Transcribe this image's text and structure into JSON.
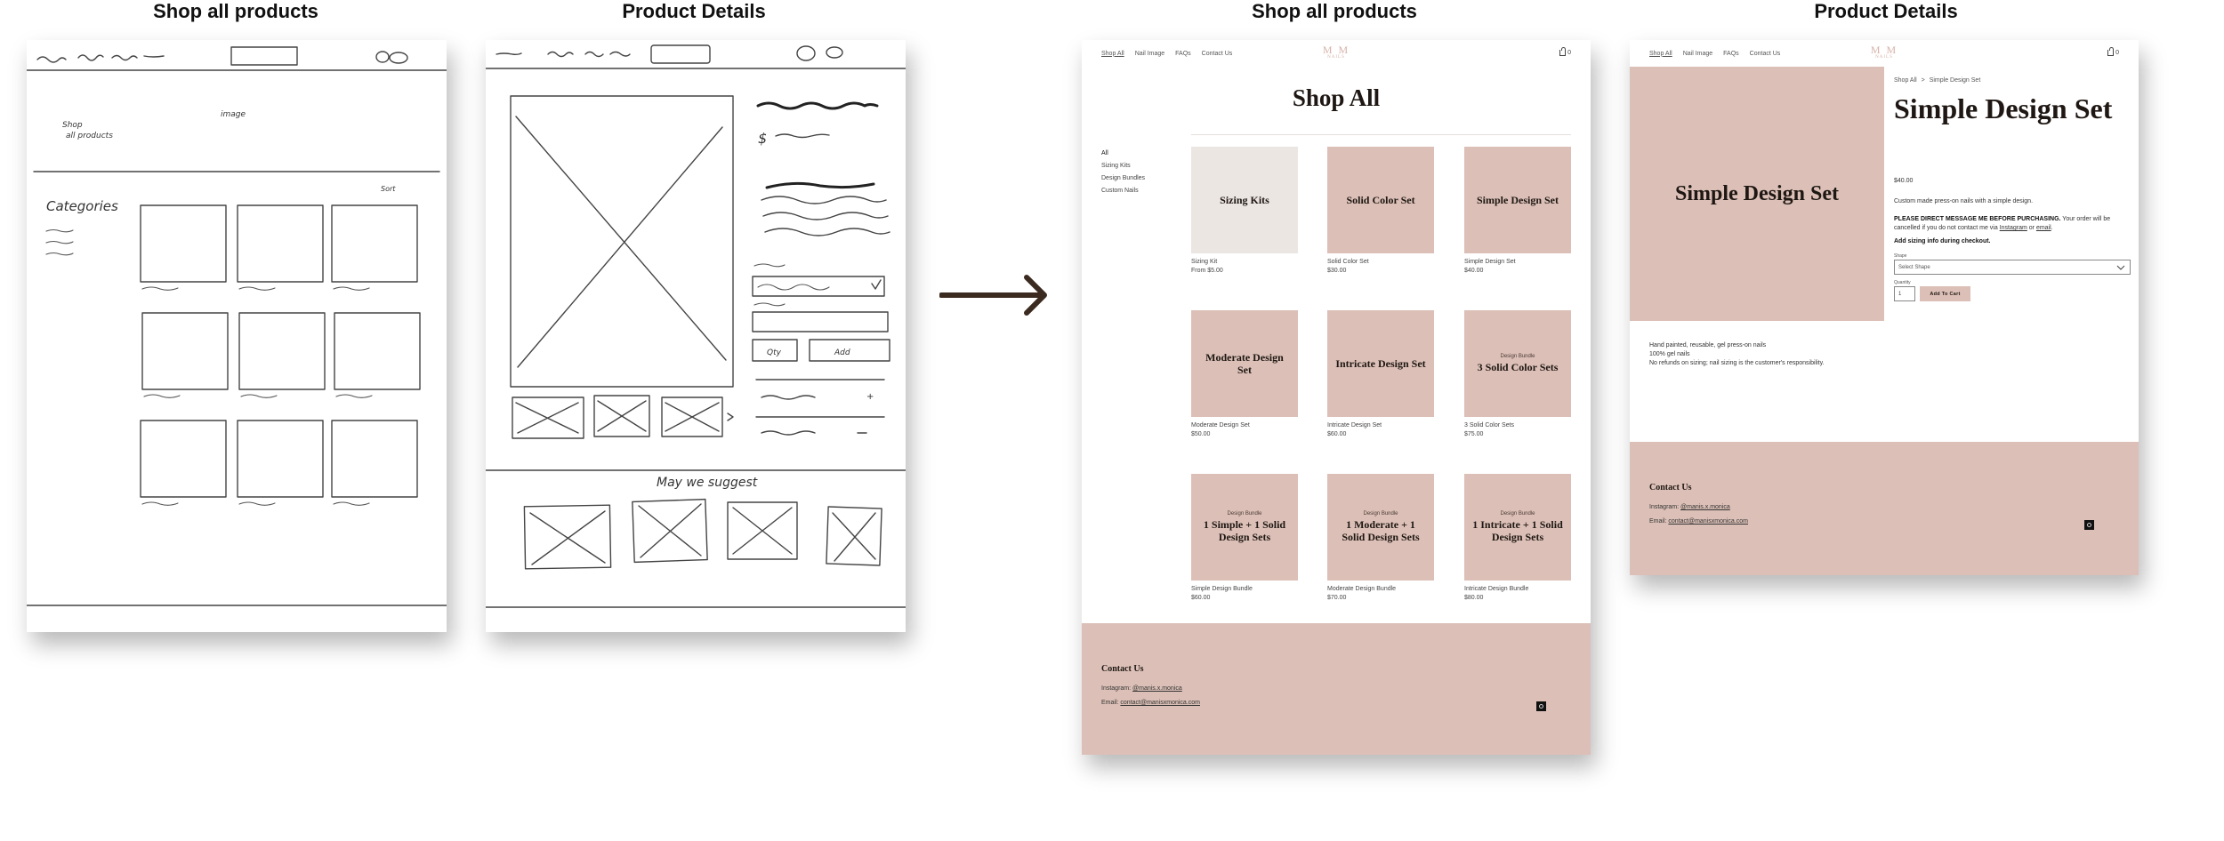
{
  "titles": {
    "sketch_shop": "Shop all products",
    "sketch_detail": "Product Details",
    "mock_shop": "Shop all products",
    "mock_detail": "Product Details"
  },
  "sketch_labels": {
    "image": "image",
    "shop_all": "Shop\nall products",
    "categories": "Categories",
    "sort": "Sort",
    "may_we_suggest": "May we suggest"
  },
  "nav": {
    "items": [
      "Shop All",
      "Nail Image",
      "FAQs",
      "Contact Us"
    ],
    "logo": "M M",
    "logo_sub": "NAILS",
    "cart_count": "0"
  },
  "shop": {
    "heading": "Shop All",
    "categories": [
      "All",
      "Sizing Kits",
      "Design Bundles",
      "Custom Nails"
    ],
    "products": [
      {
        "tag": "",
        "name": "Sizing Kits",
        "caption": "Sizing Kit",
        "price": "From $5.00",
        "bg": "#ece6e2"
      },
      {
        "tag": "",
        "name": "Solid Color Set",
        "caption": "Solid Color Set",
        "price": "$30.00",
        "bg": "#dcc0b7"
      },
      {
        "tag": "",
        "name": "Simple Design Set",
        "caption": "Simple Design Set",
        "price": "$40.00",
        "bg": "#dcc0b7"
      },
      {
        "tag": "",
        "name": "Moderate Design Set",
        "caption": "Moderate Design Set",
        "price": "$50.00",
        "bg": "#dcc0b7"
      },
      {
        "tag": "",
        "name": "Intricate Design Set",
        "caption": "Intricate Design Set",
        "price": "$60.00",
        "bg": "#dcc0b7"
      },
      {
        "tag": "Design Bundle",
        "name": "3 Solid Color Sets",
        "caption": "3 Solid Color Sets",
        "price": "$75.00",
        "bg": "#dcc0b7"
      },
      {
        "tag": "Design Bundle",
        "name": "1 Simple + 1 Solid Design Sets",
        "caption": "Simple Design Bundle",
        "price": "$60.00",
        "bg": "#dcc0b7"
      },
      {
        "tag": "Design Bundle",
        "name": "1 Moderate + 1 Solid Design Sets",
        "caption": "Moderate Design Bundle",
        "price": "$70.00",
        "bg": "#dcc0b7"
      },
      {
        "tag": "Design Bundle",
        "name": "1 Intricate + 1 Solid Design Sets",
        "caption": "Intricate Design Bundle",
        "price": "$80.00",
        "bg": "#dcc0b7"
      }
    ]
  },
  "footer": {
    "heading": "Contact Us",
    "instagram_label": "Instagram:",
    "instagram_handle": "@manis.x.monica",
    "email_label": "Email:",
    "email_value": "contact@manisxmonica.com",
    "ig_icon": "instagram-icon"
  },
  "detail": {
    "breadcrumb_root": "Shop All",
    "breadcrumb_sep": ">",
    "breadcrumb_current": "Simple Design Set",
    "image_text": "Simple Design Set",
    "title": "Simple Design Set",
    "price": "$40.00",
    "description": "Custom made press-on nails with a simple design.",
    "notice_bold": "PLEASE DIRECT MESSAGE ME BEFORE PURCHASING.",
    "notice_rest": " Your order will be cancelled if you do not contact me via ",
    "notice_link1": "Instagram",
    "notice_or": " or ",
    "notice_link2": "email",
    "notice_end": ".",
    "sizing_note": "Add sizing info during checkout.",
    "shape_label": "Shape",
    "shape_placeholder": "Select Shape",
    "quantity_label": "Quantity",
    "quantity_value": "1",
    "add_to_cart": "Add To Cart",
    "info_lines": [
      "Hand painted, reusable, gel press-on nails",
      "100% gel nails",
      "No refunds on sizing; nail sizing is the customer's responsibility."
    ]
  },
  "colors": {
    "accent_pink": "#dcc0b7",
    "light_tile": "#ece6e2",
    "heading_dark": "#1e1713",
    "arrow": "#3b2a20"
  }
}
